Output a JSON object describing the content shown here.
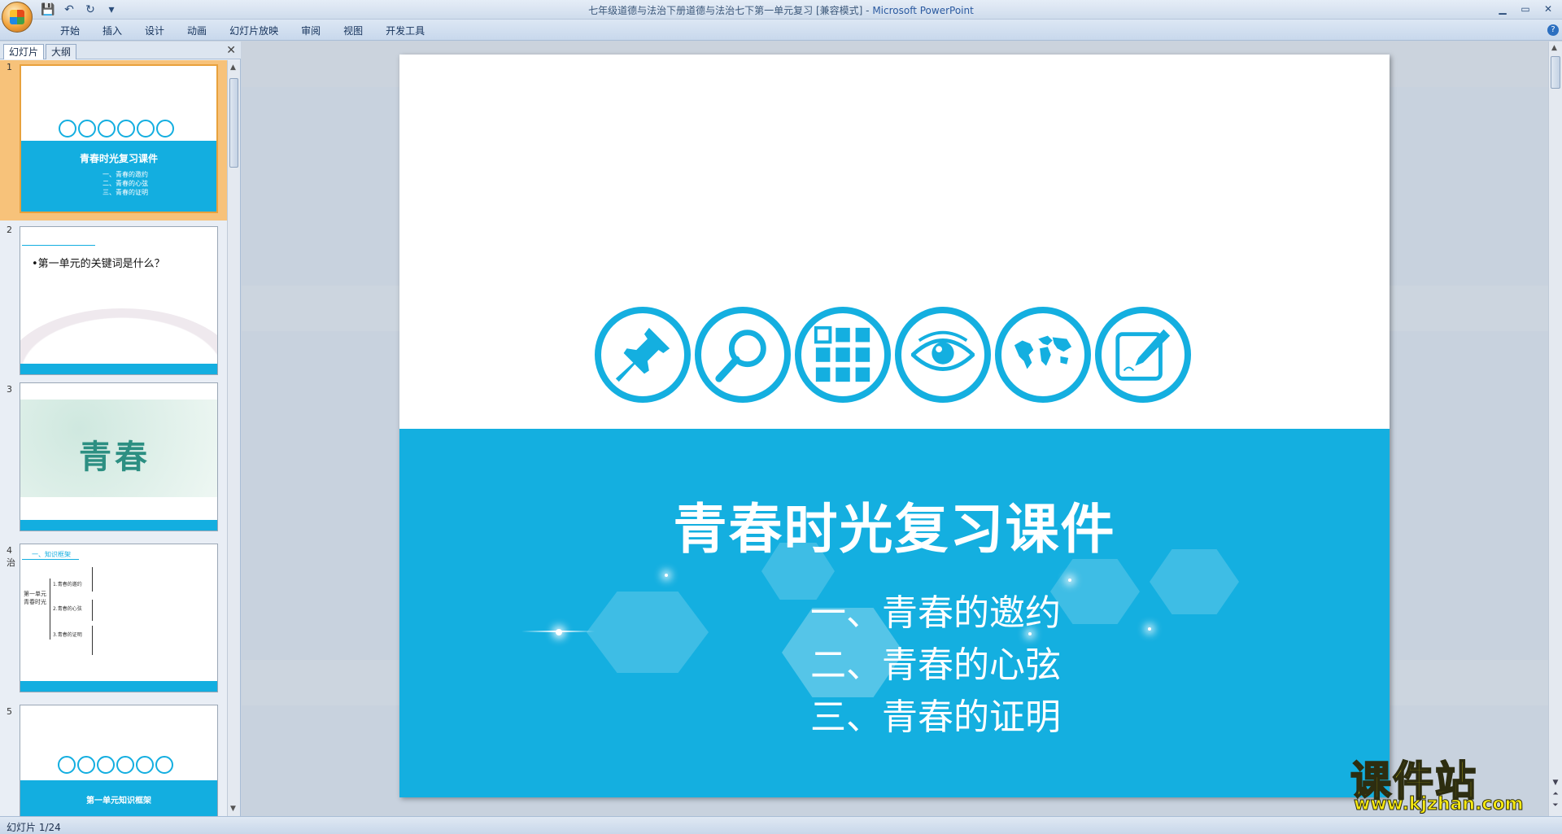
{
  "window": {
    "title": "七年级道德与法治下册道德与法治七下第一单元复习 [兼容模式] - ",
    "app_name": "Microsoft PowerPoint"
  },
  "ribbon": {
    "tabs": [
      "开始",
      "插入",
      "设计",
      "动画",
      "幻灯片放映",
      "审阅",
      "视图",
      "开发工具"
    ]
  },
  "panel": {
    "tab_slides": "幻灯片",
    "tab_outline": "大纲",
    "close": "✕"
  },
  "thumbnails": [
    {
      "num": "1",
      "title": "青春时光复习课件",
      "items": [
        "一、青春的邀约",
        "二、青春的心弦",
        "三、青春的证明"
      ]
    },
    {
      "num": "2",
      "text": "•第一单元的关键词是什么？"
    },
    {
      "num": "3",
      "title": "青春"
    },
    {
      "num": "4",
      "side": "治",
      "header": "一、知识框架",
      "root": "第一单元 青春时光",
      "branches": [
        "1.青春的邀约",
        "2.青春的心弦",
        "3.青春的证明"
      ]
    },
    {
      "num": "5",
      "title": "第一单元知识框架"
    }
  ],
  "slide": {
    "title": "青春时光复习课件",
    "items": [
      "一、青春的邀约",
      "二、青春的心弦",
      "三、青春的证明"
    ],
    "icons": [
      "pushpin-icon",
      "magnifier-icon",
      "grid-icon",
      "eye-icon",
      "world-map-icon",
      "edit-icon"
    ],
    "accent_color": "#14afe0"
  },
  "status": {
    "slide_indicator": "幻灯片 1/24"
  },
  "watermark": {
    "main": "课件站",
    "url": "www.kjzhan.com"
  }
}
